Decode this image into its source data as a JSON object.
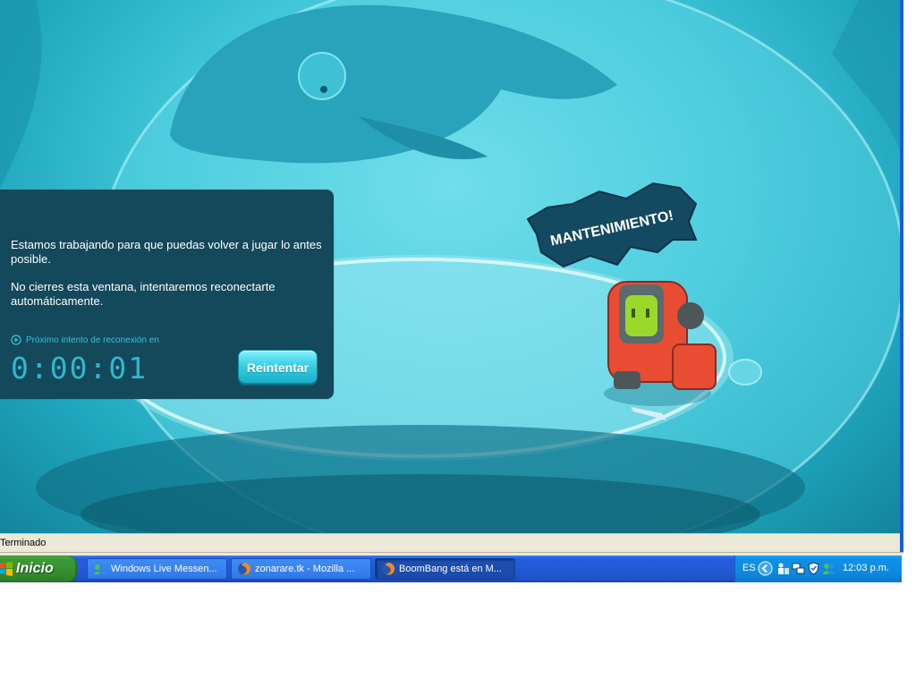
{
  "maintenance": {
    "badge_text": "MANTENIMIENTO!",
    "message_line1": "Estamos trabajando para que puedas volver a jugar lo antes posible.",
    "message_line2": "No cierres esta ventana, intentaremos reconectarte automáticamente.",
    "next_attempt_label": "Próximo intento de reconexión en",
    "countdown": "0:00:01",
    "retry_button": "Reintentar"
  },
  "browser_status": {
    "text": "Terminado"
  },
  "taskbar": {
    "start_label": "Inicio",
    "tasks": [
      {
        "label": "Windows Live Messen...",
        "icon": "messenger-icon",
        "active": false
      },
      {
        "label": "zonarare.tk - Mozilla ...",
        "icon": "firefox-icon",
        "active": false
      },
      {
        "label": "BoomBang está en M...",
        "icon": "firefox-icon",
        "active": true
      }
    ],
    "tray": {
      "language": "ES",
      "time": "12:03 p.m.",
      "icons": [
        "show-hidden-icons-icon",
        "network-users-icon",
        "network-connection-icon",
        "security-shield-icon",
        "messenger-status-icon"
      ]
    }
  },
  "colors": {
    "panel_bg": "#14485b",
    "accent_cyan": "#2fb8cc",
    "taskbar_blue": "#245edb",
    "start_green": "#3c9a35",
    "tray_blue": "#0f91e6"
  }
}
